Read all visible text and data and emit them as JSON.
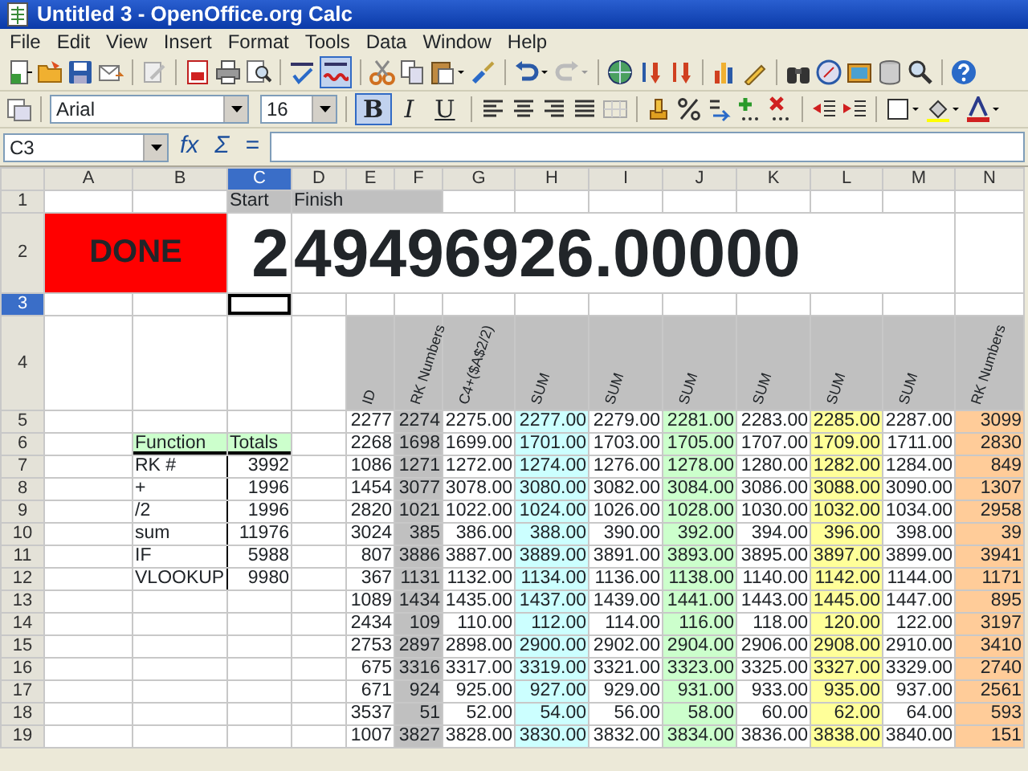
{
  "window": {
    "title": "Untitled 3 - OpenOffice.org Calc"
  },
  "menu": [
    "File",
    "Edit",
    "View",
    "Insert",
    "Format",
    "Tools",
    "Data",
    "Window",
    "Help"
  ],
  "toolbar": {
    "auto_spellcheck": true
  },
  "formatting": {
    "font_name": "Arial",
    "font_size": "16",
    "style_buttons": [
      {
        "label": "B",
        "selected": true
      },
      {
        "label": "I",
        "selected": false
      },
      {
        "label": "U",
        "selected": false
      }
    ]
  },
  "formula_bar": {
    "name_box": "C3",
    "buttons": [
      "fx",
      "Σ",
      "="
    ]
  },
  "sheet": {
    "columns": [
      {
        "label": "A",
        "selected": false
      },
      {
        "label": "B",
        "selected": false
      },
      {
        "label": "C",
        "selected": true
      },
      {
        "label": "D",
        "selected": false
      },
      {
        "label": "E",
        "selected": false
      },
      {
        "label": "F",
        "selected": false
      },
      {
        "label": "G",
        "selected": false
      },
      {
        "label": "H",
        "selected": false
      },
      {
        "label": "I",
        "selected": false
      },
      {
        "label": "J",
        "selected": false
      },
      {
        "label": "K",
        "selected": false
      },
      {
        "label": "L",
        "selected": false
      },
      {
        "label": "M",
        "selected": false
      },
      {
        "label": "N",
        "selected": false
      }
    ],
    "rows": [
      {
        "label": "1",
        "selected": false
      },
      {
        "label": "2",
        "selected": false
      },
      {
        "label": "3",
        "selected": true
      },
      {
        "label": "4",
        "selected": false
      },
      {
        "label": "5",
        "selected": false
      },
      {
        "label": "6",
        "selected": false
      },
      {
        "label": "7",
        "selected": false
      },
      {
        "label": "8",
        "selected": false
      },
      {
        "label": "9",
        "selected": false
      },
      {
        "label": "10",
        "selected": false
      },
      {
        "label": "11",
        "selected": false
      },
      {
        "label": "12",
        "selected": false
      },
      {
        "label": "13",
        "selected": false
      },
      {
        "label": "14",
        "selected": false
      },
      {
        "label": "15",
        "selected": false
      },
      {
        "label": "16",
        "selected": false
      },
      {
        "label": "17",
        "selected": false
      },
      {
        "label": "18",
        "selected": false
      },
      {
        "label": "19",
        "selected": false
      }
    ],
    "banner": {
      "status": "DONE",
      "start_label": "Start",
      "finish_label": "Finish",
      "start": "2",
      "finish": "49496926.00000"
    },
    "function_table": {
      "headers": [
        "Function",
        "Totals"
      ],
      "rows": [
        {
          "function": "RK #",
          "total": "3992"
        },
        {
          "function": "+",
          "total": "1996"
        },
        {
          "function": "/2",
          "total": "1996"
        },
        {
          "function": "sum",
          "total": "11976"
        },
        {
          "function": "IF",
          "total": "5988"
        },
        {
          "function": "VLOOKUP",
          "total": "9980"
        }
      ]
    },
    "data_table": {
      "columns": [
        {
          "header": "ID",
          "color": "#ffffff"
        },
        {
          "header": "RK Numbers",
          "color": "#c0c0c0"
        },
        {
          "header": "C4+($A$2/2)",
          "color": "#ffffff"
        },
        {
          "header": "SUM",
          "color": "#ccffff"
        },
        {
          "header": "SUM",
          "color": "#ffffff"
        },
        {
          "header": "SUM",
          "color": "#ccffcc"
        },
        {
          "header": "SUM",
          "color": "#ffffff"
        },
        {
          "header": "SUM",
          "color": "#ffff99"
        },
        {
          "header": "SUM",
          "color": "#ffffff"
        },
        {
          "header": "RK Numbers",
          "color": "#ffcc99"
        }
      ],
      "rows": [
        [
          "2277",
          "2274",
          "2275.00",
          "2277.00",
          "2279.00",
          "2281.00",
          "2283.00",
          "2285.00",
          "2287.00",
          "3099"
        ],
        [
          "2268",
          "1698",
          "1699.00",
          "1701.00",
          "1703.00",
          "1705.00",
          "1707.00",
          "1709.00",
          "1711.00",
          "2830"
        ],
        [
          "1086",
          "1271",
          "1272.00",
          "1274.00",
          "1276.00",
          "1278.00",
          "1280.00",
          "1282.00",
          "1284.00",
          "849"
        ],
        [
          "1454",
          "3077",
          "3078.00",
          "3080.00",
          "3082.00",
          "3084.00",
          "3086.00",
          "3088.00",
          "3090.00",
          "1307"
        ],
        [
          "2820",
          "1021",
          "1022.00",
          "1024.00",
          "1026.00",
          "1028.00",
          "1030.00",
          "1032.00",
          "1034.00",
          "2958"
        ],
        [
          "3024",
          "385",
          "386.00",
          "388.00",
          "390.00",
          "392.00",
          "394.00",
          "396.00",
          "398.00",
          "39"
        ],
        [
          "807",
          "3886",
          "3887.00",
          "3889.00",
          "3891.00",
          "3893.00",
          "3895.00",
          "3897.00",
          "3899.00",
          "3941"
        ],
        [
          "367",
          "1131",
          "1132.00",
          "1134.00",
          "1136.00",
          "1138.00",
          "1140.00",
          "1142.00",
          "1144.00",
          "1171"
        ],
        [
          "1089",
          "1434",
          "1435.00",
          "1437.00",
          "1439.00",
          "1441.00",
          "1443.00",
          "1445.00",
          "1447.00",
          "895"
        ],
        [
          "2434",
          "109",
          "110.00",
          "112.00",
          "114.00",
          "116.00",
          "118.00",
          "120.00",
          "122.00",
          "3197"
        ],
        [
          "2753",
          "2897",
          "2898.00",
          "2900.00",
          "2902.00",
          "2904.00",
          "2906.00",
          "2908.00",
          "2910.00",
          "3410"
        ],
        [
          "675",
          "3316",
          "3317.00",
          "3319.00",
          "3321.00",
          "3323.00",
          "3325.00",
          "3327.00",
          "3329.00",
          "2740"
        ],
        [
          "671",
          "924",
          "925.00",
          "927.00",
          "929.00",
          "931.00",
          "933.00",
          "935.00",
          "937.00",
          "2561"
        ],
        [
          "3537",
          "51",
          "52.00",
          "54.00",
          "56.00",
          "58.00",
          "60.00",
          "62.00",
          "64.00",
          "593"
        ],
        [
          "1007",
          "3827",
          "3828.00",
          "3830.00",
          "3832.00",
          "3834.00",
          "3836.00",
          "3838.00",
          "3840.00",
          "151"
        ]
      ]
    }
  }
}
